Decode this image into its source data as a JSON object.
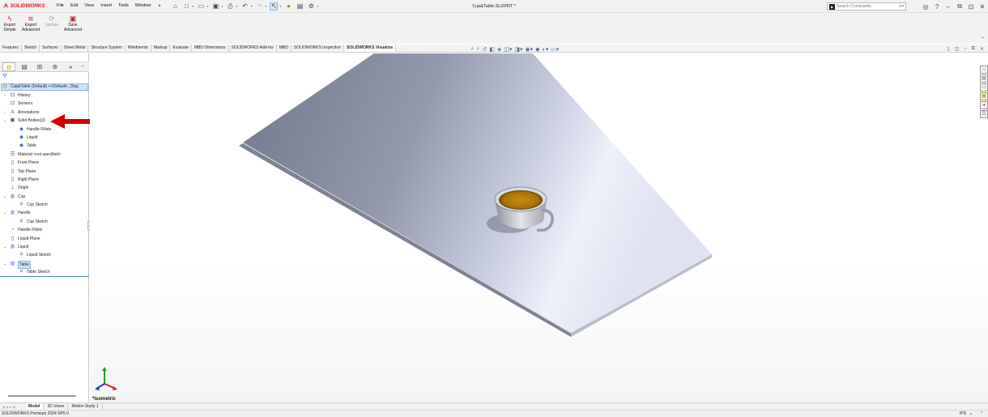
{
  "app": {
    "logo_mark": "ᗑ",
    "logo_text": "SOLIDWORKS",
    "document_title": "Cup&Table.SLDPRT *",
    "brand_color": "#d9232e"
  },
  "menu": [
    "File",
    "Edit",
    "View",
    "Insert",
    "Tools",
    "Window"
  ],
  "search": {
    "placeholder": "Search Commands"
  },
  "commands": [
    {
      "label": "Export\nSimple",
      "icon": "lightning-icon",
      "enabled": true
    },
    {
      "label": "Export\nAdvanced",
      "icon": "export-advanced-icon",
      "enabled": true
    },
    {
      "label": "Update",
      "icon": "update-icon",
      "enabled": false
    },
    {
      "label": "Save\nAdvanced",
      "icon": "save-advanced-icon",
      "enabled": true
    }
  ],
  "tabs": [
    "Features",
    "Sketch",
    "Surfaces",
    "Sheet Metal",
    "Structure System",
    "Weldments",
    "Markup",
    "Evaluate",
    "MBD Dimensions",
    "SOLIDWORKS Add-Ins",
    "MBD",
    "SOLIDWORKS Inspection",
    "SOLIDWORKS Visualize"
  ],
  "active_tab": "SOLIDWORKS Visualize",
  "feature_tree": {
    "root": "Cup&Table (Default) <<Default>_Disp",
    "nodes": [
      {
        "label": "History",
        "indent": 0,
        "expander": "›",
        "icon": "history-icon"
      },
      {
        "label": "Sensors",
        "indent": 0,
        "expander": "",
        "icon": "sensors-icon"
      },
      {
        "label": "Annotations",
        "indent": 0,
        "expander": "›",
        "icon": "annotations-icon"
      },
      {
        "label": "Solid Bodies(3)",
        "indent": 0,
        "expander": "⌄",
        "icon": "solid-bodies-folder-icon"
      },
      {
        "label": "Handle Fillets",
        "indent": 1,
        "expander": "",
        "icon": "body-icon"
      },
      {
        "label": "Liquid",
        "indent": 1,
        "expander": "",
        "icon": "body-icon"
      },
      {
        "label": "Table",
        "indent": 1,
        "expander": "",
        "icon": "body-icon"
      },
      {
        "label": "Material <not specified>",
        "indent": 0,
        "expander": "",
        "icon": "material-icon"
      },
      {
        "label": "Front Plane",
        "indent": 0,
        "expander": "",
        "icon": "plane-icon"
      },
      {
        "label": "Top Plane",
        "indent": 0,
        "expander": "",
        "icon": "plane-icon"
      },
      {
        "label": "Right Plane",
        "indent": 0,
        "expander": "",
        "icon": "plane-icon"
      },
      {
        "label": "Origin",
        "indent": 0,
        "expander": "",
        "icon": "origin-icon"
      },
      {
        "label": "Cup",
        "indent": 0,
        "expander": "⌄",
        "icon": "revolve-feature-icon"
      },
      {
        "label": "Cup Sketch",
        "indent": 1,
        "expander": "",
        "icon": "sketch-icon"
      },
      {
        "label": "Handle",
        "indent": 0,
        "expander": "⌄",
        "icon": "sweep-feature-icon"
      },
      {
        "label": "Cup Sketch",
        "indent": 1,
        "expander": "",
        "icon": "sketch-icon"
      },
      {
        "label": "Handle Fillets",
        "indent": 0,
        "expander": "",
        "icon": "fillet-icon"
      },
      {
        "label": "Liquid Plane",
        "indent": 0,
        "expander": "",
        "icon": "plane-icon"
      },
      {
        "label": "Liquid",
        "indent": 0,
        "expander": "⌄",
        "icon": "extrude-feature-icon"
      },
      {
        "label": "Liquid Sketch",
        "indent": 1,
        "expander": "",
        "icon": "sketch-icon"
      },
      {
        "label": "Table",
        "indent": 0,
        "expander": "⌄",
        "icon": "extrude-feature-icon",
        "selected": true
      },
      {
        "label": "Table Sketch",
        "indent": 1,
        "expander": "",
        "icon": "sketch-icon"
      }
    ]
  },
  "viewport": {
    "view_name": "*Isometric",
    "annotation_arrow_color": "#d40000"
  },
  "bottom_tabs": [
    "Model",
    "3D Views",
    "Motion Study 1"
  ],
  "active_bottom_tab": "Model",
  "status": {
    "product": "SOLIDWORKS Premium 2024 SP5.0",
    "units": "IPS"
  }
}
